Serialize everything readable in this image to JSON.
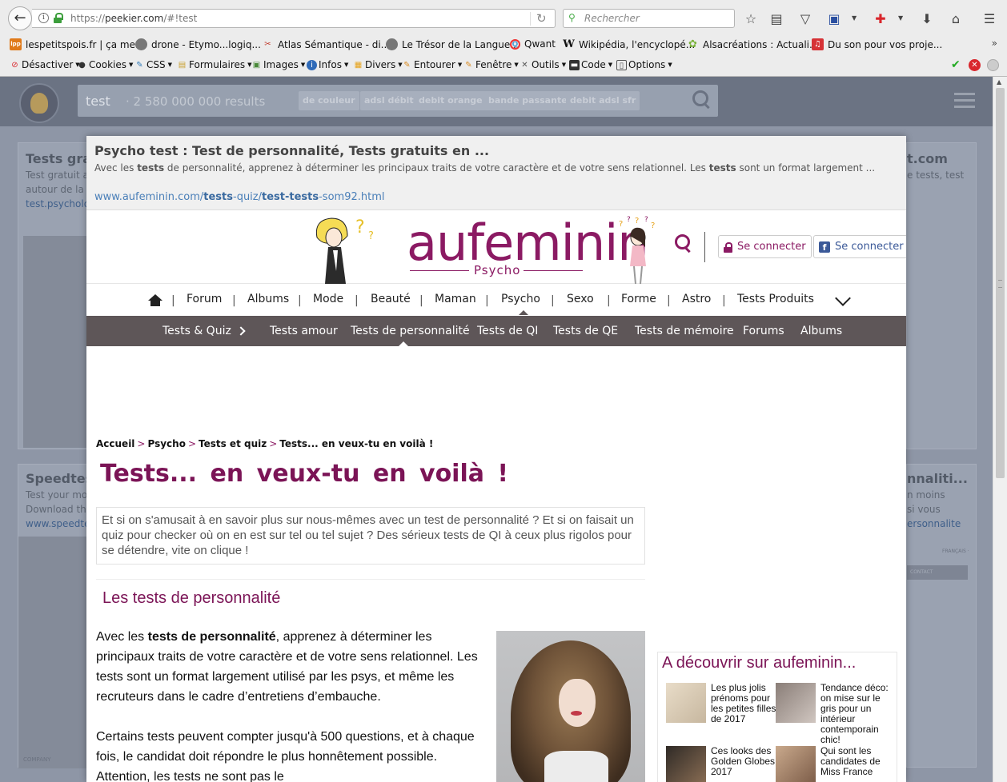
{
  "browser": {
    "url_prefix": "https://",
    "url_host": "peekier.com",
    "url_path": "/#!test",
    "search_placeholder": "Rechercher"
  },
  "bookmarks": [
    {
      "label": "lespetitspois.fr | ça me...",
      "icon": "lpp-favicon",
      "color": "#e07a1a",
      "glyph": "lpp"
    },
    {
      "label": "drone - Etymo...logiq...",
      "icon": "globe-icon",
      "color": "#777777",
      "glyph": ""
    },
    {
      "label": "Atlas Sémantique - di...",
      "icon": "atlas-favicon",
      "color": "#c0392b",
      "glyph": "✂"
    },
    {
      "label": "Le Trésor de la Langue...",
      "icon": "globe-icon",
      "color": "#777777",
      "glyph": ""
    },
    {
      "label": "Qwant",
      "icon": "qwant-favicon",
      "color": "#4aa0d8",
      "glyph": "Q"
    },
    {
      "label": "Wikipédia, l'encyclopé...",
      "icon": "wikipedia-favicon",
      "color": "#ffffff",
      "glyph": "W"
    },
    {
      "label": "Alsacréations : Actuali...",
      "icon": "alsacreations-favicon",
      "color": "#7ab23b",
      "glyph": "✿"
    },
    {
      "label": "Du son pour vos proje...",
      "icon": "sound-favicon",
      "color": "#d63236",
      "glyph": "♫"
    }
  ],
  "devtoolbar": [
    {
      "label": "Désactiver",
      "icon": "disable-icon",
      "color": "#d9262c",
      "glyph": "⊘"
    },
    {
      "label": "Cookies",
      "icon": "cookies-icon",
      "color": "#333333",
      "glyph": "●"
    },
    {
      "label": "CSS",
      "icon": "css-icon",
      "color": "#2f7ab8",
      "glyph": "✎"
    },
    {
      "label": "Formulaires",
      "icon": "forms-icon",
      "color": "#c9a032",
      "glyph": "▤"
    },
    {
      "label": "Images",
      "icon": "images-icon",
      "color": "#4a8a3a",
      "glyph": "▣"
    },
    {
      "label": "Infos",
      "icon": "info-icon",
      "color": "#2f6ab8",
      "glyph": "i"
    },
    {
      "label": "Divers",
      "icon": "misc-icon",
      "color": "#e6a21a",
      "glyph": "▦"
    },
    {
      "label": "Entourer",
      "icon": "outline-icon",
      "color": "#d98a20",
      "glyph": "✎"
    },
    {
      "label": "Fenêtre",
      "icon": "window-icon",
      "color": "#d98a20",
      "glyph": "✎"
    },
    {
      "label": "Outils",
      "icon": "tools-icon",
      "color": "#555555",
      "glyph": "✕"
    },
    {
      "label": "Code",
      "icon": "code-icon",
      "color": "#333333",
      "glyph": "▬"
    },
    {
      "label": "Options",
      "icon": "options-icon",
      "color": "#555555",
      "glyph": "▯"
    }
  ],
  "peekier": {
    "query": "test",
    "count": "·  2 580 000 000 results",
    "suggestions": [
      "de couleur",
      "adsl débit",
      "debit orange",
      "bande passante",
      "debit adsl sfr"
    ],
    "bg_left_title": "Tests gratu",
    "bg_left_desc1": "Test gratuit a",
    "bg_left_desc2": "autour de la",
    "bg_left_link": "test.psycholo",
    "bg_right_title": "t.com",
    "bg_right_desc": "e tests, test",
    "bg2_left_title": "Speedtest",
    "bg2_left_desc1": "Test your mo",
    "bg2_left_desc2": "Download th",
    "bg2_left_link": "www.speedte",
    "bg2_right_title": "nnaliti...",
    "bg2_right_desc1": "n moins",
    "bg2_right_desc2": "si vous",
    "bg2_right_link": "ersonnalite",
    "bg_company": "COMPANY",
    "bg_francais": "FRANÇAIS ·",
    "bg_contact": "CONTACT"
  },
  "popup": {
    "title": "Psycho test : Test de personnalité, Tests gratuits en ...",
    "desc_a": "Avec les ",
    "desc_b": "tests",
    "desc_c": " de personnalité, apprenez à déterminer les principaux traits de votre caractère et de votre sens relationnel. Les ",
    "desc_d": "tests",
    "desc_e": " sont un format largement ...",
    "url_a": "www.aufeminin.com/",
    "url_b": "tests",
    "url_c": "-quiz/",
    "url_d": "test-tests",
    "url_e": "-som92.html"
  },
  "site": {
    "logo": "aufeminin",
    "logo_sub": "Psycho",
    "login_label": "Se connecter",
    "fb_login_label": "Se connecter",
    "nav": [
      "Forum",
      "Albums",
      "Mode",
      "Beauté",
      "Maman",
      "Psycho",
      "Sexo",
      "Forme",
      "Astro",
      "Tests Produits"
    ],
    "subnav": [
      "Tests & Quiz",
      "Tests amour",
      "Tests de personnalité",
      "Tests de QI",
      "Tests de QE",
      "Tests de mémoire",
      "Forums",
      "Albums"
    ],
    "breadcrumb": [
      "Accueil",
      "Psycho",
      "Tests et quiz",
      "Tests... en veux-tu en voilà !"
    ],
    "h1": "Tests...  en  veux-tu  en  voilà !",
    "intro": "Et si on s'amusait à en savoir plus sur nous-mêmes avec un test de personnalité ? Et si on faisait un quiz pour checker où on en est sur tel ou tel sujet ? Des sérieux tests de QI à ceux plus rigolos pour se détendre, vite on clique !",
    "h2": "Les tests de personnalité",
    "p1_a": "Avec les ",
    "p1_b": "tests de personnalité",
    "p1_c": ", apprenez à déterminer les principaux traits de votre caractère et de votre sens relationnel. Les tests sont un format largement utilisé par les psys, et même les recruteurs dans le cadre d’entretiens d’embauche.",
    "p2": "Certains tests peuvent compter jusqu'à 500 questions, et à chaque fois, le candidat doit répondre le plus honnêtement possible. Attention, les tests ne sont pas le",
    "discover_title": "A découvrir sur aufeminin...",
    "discover": [
      {
        "text": "Les plus jolis prénoms pour les petites filles de 2017"
      },
      {
        "text": "Tendance déco: on mise sur le gris pour un intérieur contemporain chic!"
      },
      {
        "text": "Ces looks des Golden Globes 2017"
      },
      {
        "text": "Qui sont les candidates de Miss France"
      }
    ],
    "brand_color": "#8b1a63"
  }
}
